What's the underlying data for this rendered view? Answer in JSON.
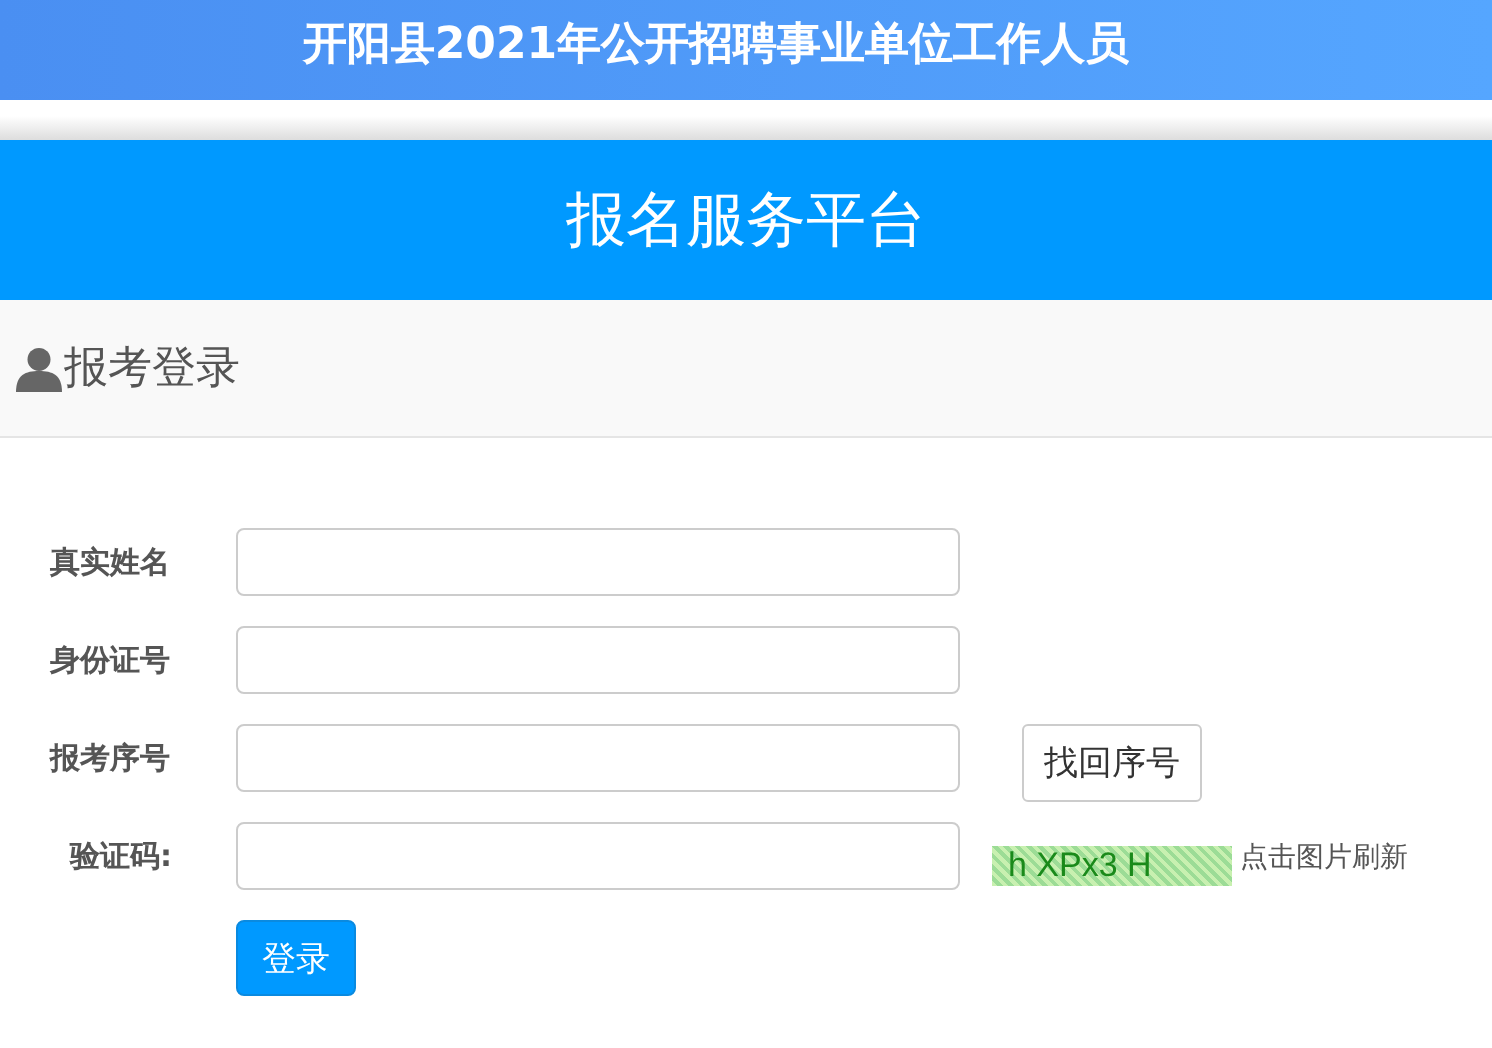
{
  "banner": {
    "title": "开阳县2021年公开招聘事业单位工作人员"
  },
  "platform": {
    "title": "报名服务平台"
  },
  "panel": {
    "heading": "报考登录"
  },
  "fields": [
    {
      "kind": "text",
      "label": "真实姓名"
    },
    {
      "kind": "text",
      "label": "身份证号"
    },
    {
      "kind": "recover",
      "label": "报考序号",
      "button": "找回序号"
    },
    {
      "kind": "captcha",
      "label": "验证码:",
      "captcha": "h XPx3 H",
      "hint": "点击图片刷新"
    }
  ],
  "submit": "登录"
}
